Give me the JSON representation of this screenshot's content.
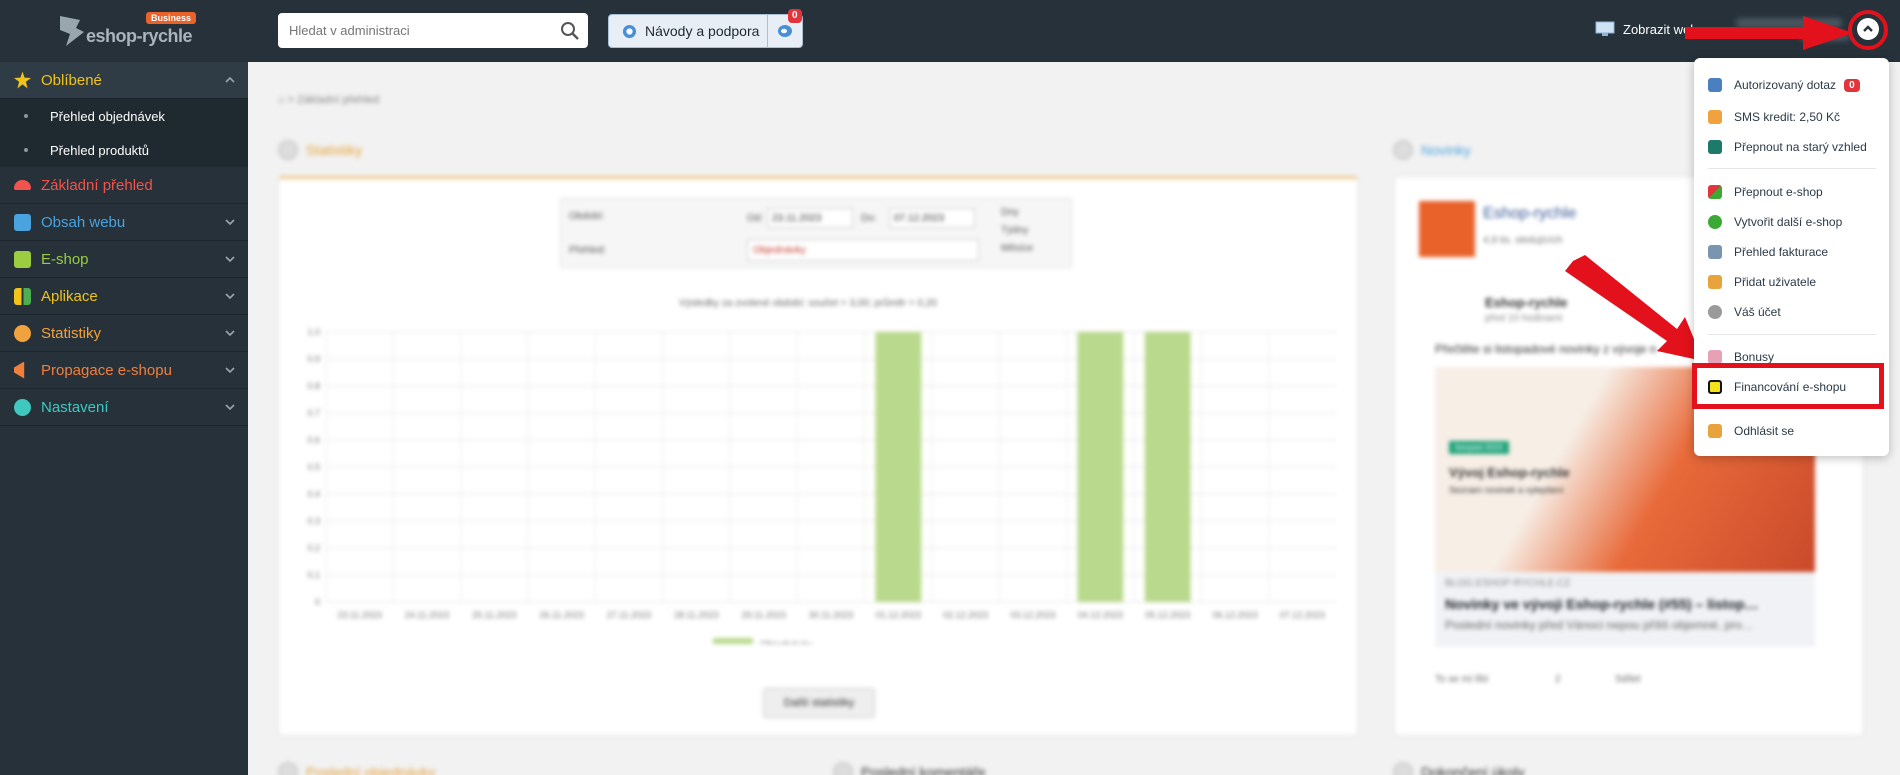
{
  "brand": {
    "name": "eshop-rychle",
    "badge": "Business"
  },
  "search": {
    "placeholder": "Hledat v administraci"
  },
  "help": {
    "label": "Návody a podpora"
  },
  "chat": {
    "badge": "0"
  },
  "header": {
    "view_web": "Zobrazit web"
  },
  "sidebar": {
    "items": [
      {
        "label": "Oblíbené",
        "icon": "star-icon",
        "color": "#f0c419"
      },
      {
        "label": "Základní přehled",
        "icon": "speedometer-icon",
        "color": "#f0544c"
      },
      {
        "label": "Obsah webu",
        "icon": "document-edit-icon",
        "color": "#4aa3df"
      },
      {
        "label": "E-shop",
        "icon": "basket-icon",
        "color": "#9ccc3f"
      },
      {
        "label": "Aplikace",
        "icon": "grid-icon",
        "color": "#f0c419"
      },
      {
        "label": "Statistiky",
        "icon": "chart-pie-icon",
        "color": "#f0a23e"
      },
      {
        "label": "Propagace e-shopu",
        "icon": "megaphone-icon",
        "color": "#f07f3c"
      },
      {
        "label": "Nastavení",
        "icon": "gear-icon",
        "color": "#3fc7c0"
      }
    ],
    "favorites": [
      "Přehled objednávek",
      "Přehled produktů"
    ]
  },
  "content": {
    "breadcrumb": "Základní přehled",
    "stats_title": "Statistiky",
    "news_title": "Novinky",
    "filter": {
      "obdobi_label": "Období:",
      "od_label": "Od:",
      "od_value": "23.11.2023",
      "do_label": "Do:",
      "do_value": "07.12.2023",
      "prehled_label": "Přehled:",
      "prehled_value": "Objednávky",
      "radios": [
        "Dny",
        "Týdny",
        "Měsíce"
      ]
    },
    "chart_caption": "Výsledky za zvolené období: součet = 3,00; průměr = 0,20",
    "more_stats": "Další statistiky",
    "news": {
      "page": "Eshop-rychle",
      "likes": "4,9 tis. sledujících",
      "post_author": "Eshop-rychle",
      "post_time": "před 10 hodinami",
      "post_text": "Přečtěte si listopadové novinky z vývoje n",
      "card_tag": "listopad 2023",
      "card_title": "Vývoj Eshop-rychle",
      "card_sub": "Seznam novinek a vylepšení",
      "link_domain": "BLOG.ESHOP-RYCHLE.CZ",
      "link_title": "Novinky ve vývoji Eshop-rychle (#55) – listop…",
      "link_desc": "Poslední novinky před Vánoci nepou příliš objemné, pro…",
      "actions": [
        "To se mi líbí",
        "2",
        "Sdílet"
      ]
    },
    "bottom_titles": [
      "Poslední objednávky",
      "Poslední komentáře",
      "Dokončení úkoly"
    ]
  },
  "chart_data": {
    "type": "bar",
    "categories": [
      "23.11.2023",
      "24.11.2023",
      "25.11.2023",
      "26.11.2023",
      "27.11.2023",
      "28.11.2023",
      "29.11.2023",
      "30.11.2023",
      "01.12.2023",
      "02.12.2023",
      "03.12.2023",
      "04.12.2023",
      "05.12.2023",
      "06.12.2023",
      "07.12.2023"
    ],
    "series": [
      {
        "name": "Objednávky",
        "values": [
          0,
          0,
          0,
          0,
          0,
          0,
          0,
          0,
          1,
          0,
          0,
          1,
          1,
          0,
          0
        ],
        "color": "#b9d98c"
      }
    ],
    "ylim": [
      0,
      1.0
    ],
    "yticks": [
      "1.0",
      "0.9",
      "0.8",
      "0.7",
      "0.6",
      "0.5",
      "0.4",
      "0.3",
      "0.2",
      "0.1",
      "0"
    ],
    "grid": true,
    "legend": "bottom"
  },
  "dropdown": {
    "items": [
      {
        "label": "Autorizovaný dotaz",
        "icon": "chat-icon",
        "color": "#4a7fc1",
        "badge": "0"
      },
      {
        "label": "SMS kredit: 2,50 Kč",
        "icon": "sms-icon",
        "color": "#f0a23e"
      },
      {
        "label": "Přepnout na starý vzhled",
        "icon": "arrow-right-box-icon",
        "color": "#1d7a6b"
      },
      {
        "label": "Přepnout e-shop",
        "icon": "switch-icon",
        "color": "#e2343a"
      },
      {
        "label": "Vytvořit další e-shop",
        "icon": "plus-circle-icon",
        "color": "#3aaa35"
      },
      {
        "label": "Přehled fakturace",
        "icon": "invoice-icon",
        "color": "#7a95b0"
      },
      {
        "label": "Přidat uživatele",
        "icon": "users-icon",
        "color": "#e8a33d"
      },
      {
        "label": "Váš účet",
        "icon": "gear-icon",
        "color": "#9a9a9a"
      },
      {
        "label": "Bonusy",
        "icon": "gift-icon",
        "color": "#e8a0b4"
      },
      {
        "label": "Financování e-shopu",
        "icon": "wallet-icon",
        "color": "#f5e21a"
      },
      {
        "label": "Odhlásit se",
        "icon": "lock-icon",
        "color": "#e8a33d"
      }
    ]
  }
}
